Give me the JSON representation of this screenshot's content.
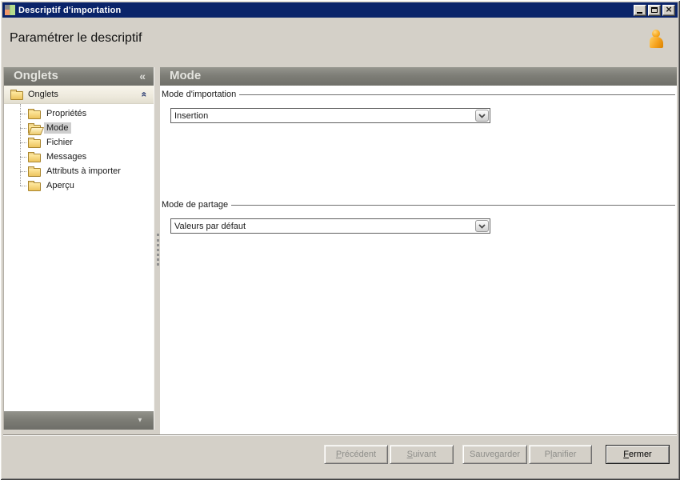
{
  "window": {
    "title": "Descriptif d'importation",
    "close_glyph": "×"
  },
  "page": {
    "title": "Paramétrer le descriptif"
  },
  "icons": {
    "collapse_sidebar": "«",
    "collapse_all": "«",
    "scroll_down": "▼"
  },
  "sidebar": {
    "header": "Onglets",
    "root_label": "Onglets",
    "items": [
      {
        "label": "Propriétés",
        "selected": false
      },
      {
        "label": "Mode",
        "selected": true
      },
      {
        "label": "Fichier",
        "selected": false
      },
      {
        "label": "Messages",
        "selected": false
      },
      {
        "label": "Attributs à importer",
        "selected": false
      },
      {
        "label": "Aperçu",
        "selected": false
      }
    ]
  },
  "main": {
    "header": "Mode",
    "groups": [
      {
        "label": "Mode d'importation",
        "value": "Insertion"
      },
      {
        "label": "Mode de partage",
        "value": "Valeurs par défaut"
      }
    ]
  },
  "footer": {
    "buttons": [
      {
        "pre": "",
        "key": "P",
        "post": "récédent",
        "enabled": false
      },
      {
        "pre": "",
        "key": "S",
        "post": "uivant",
        "enabled": false
      },
      {
        "pre": "Sauvegarder",
        "key": "",
        "post": "",
        "enabled": false
      },
      {
        "pre": "P",
        "key": "l",
        "post": "anifier",
        "enabled": false
      },
      {
        "pre": "",
        "key": "F",
        "post": "ermer",
        "enabled": true
      }
    ]
  },
  "colors": {
    "titlebar": "#0a246a",
    "dialog_bg": "#d4d0c8",
    "panel_header": "#7e7e77",
    "person_accent": "#f5a11c",
    "folder": "#edc45e"
  }
}
